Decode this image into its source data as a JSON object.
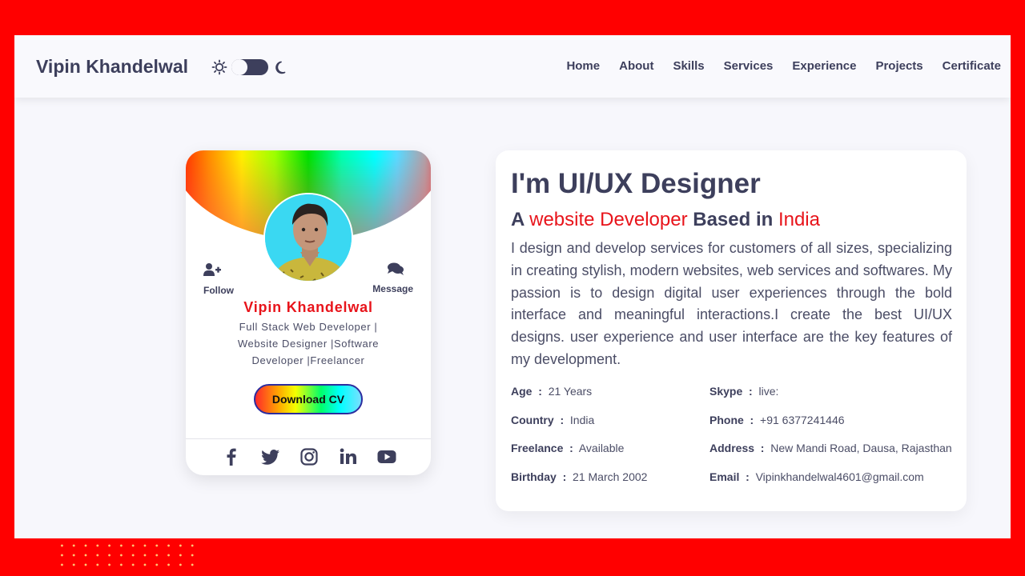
{
  "nav": {
    "brand": "Vipin Khandelwal",
    "links": [
      "Home",
      "About",
      "Skills",
      "Services",
      "Experience",
      "Projects",
      "Certificate"
    ],
    "theme_icons": [
      "sun-icon",
      "moon-icon"
    ],
    "theme_mode": "dark"
  },
  "card": {
    "follow_label": "Follow",
    "message_label": "Message",
    "name": "Vipin Khandelwal",
    "role": "Full Stack Web Developer | Website Designer |Software Developer |Freelancer",
    "cv_button": "Download CV",
    "socials": [
      "facebook-icon",
      "twitter-icon",
      "instagram-icon",
      "linkedin-icon",
      "youtube-icon"
    ]
  },
  "about": {
    "title": "I'm UI/UX Designer",
    "subtitle": {
      "p1": "A",
      "hl1": "website Developer",
      "p2": "Based in",
      "hl2": "India"
    },
    "description": "I design and develop services for customers of all sizes, specializing in creating stylish, modern websites, web services and softwares. My passion is to design digital user experiences through the bold interface and meaningful interactions.I create the best UI/UX designs. user experience and user interface are the key features of my development.",
    "info": [
      {
        "label": "Age",
        "value": "21 Years"
      },
      {
        "label": "Skype",
        "value": "live:"
      },
      {
        "label": "Country",
        "value": "India"
      },
      {
        "label": "Phone",
        "value": "+91 6377241446"
      },
      {
        "label": "Freelance",
        "value": "Available"
      },
      {
        "label": "Address",
        "value": "New Mandi Road, Dausa, Rajasthan"
      },
      {
        "label": "Birthday",
        "value": "21 March 2002"
      },
      {
        "label": "Email",
        "value": "Vipinkhandelwal4601@gmail.com"
      }
    ]
  },
  "colors": {
    "frame_border": "#ff0000",
    "text_dark": "#3d3f5c",
    "accent_red": "#e8141b"
  }
}
